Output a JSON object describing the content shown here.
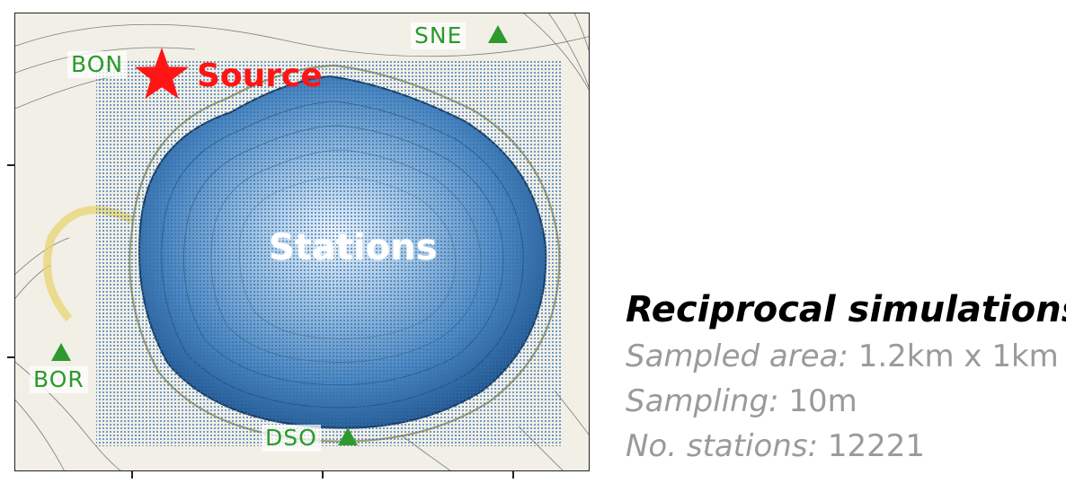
{
  "map": {
    "source_label": "Source",
    "stations_label": "Stations",
    "stations": [
      {
        "name": "BON"
      },
      {
        "name": "SNE"
      },
      {
        "name": "BOR"
      },
      {
        "name": "DSO"
      }
    ],
    "colors": {
      "source": "#ff1515",
      "station": "#2e9a2e",
      "grid": "#2f6fb0",
      "crater": "#2c64a6"
    }
  },
  "panel": {
    "title": "Reciprocal simulations",
    "lines": [
      {
        "key": "Sampled area:",
        "value": "1.2km x 1km"
      },
      {
        "key": "Sampling:",
        "value": "10m"
      },
      {
        "key": "No. stations:",
        "value": "12221"
      }
    ]
  }
}
